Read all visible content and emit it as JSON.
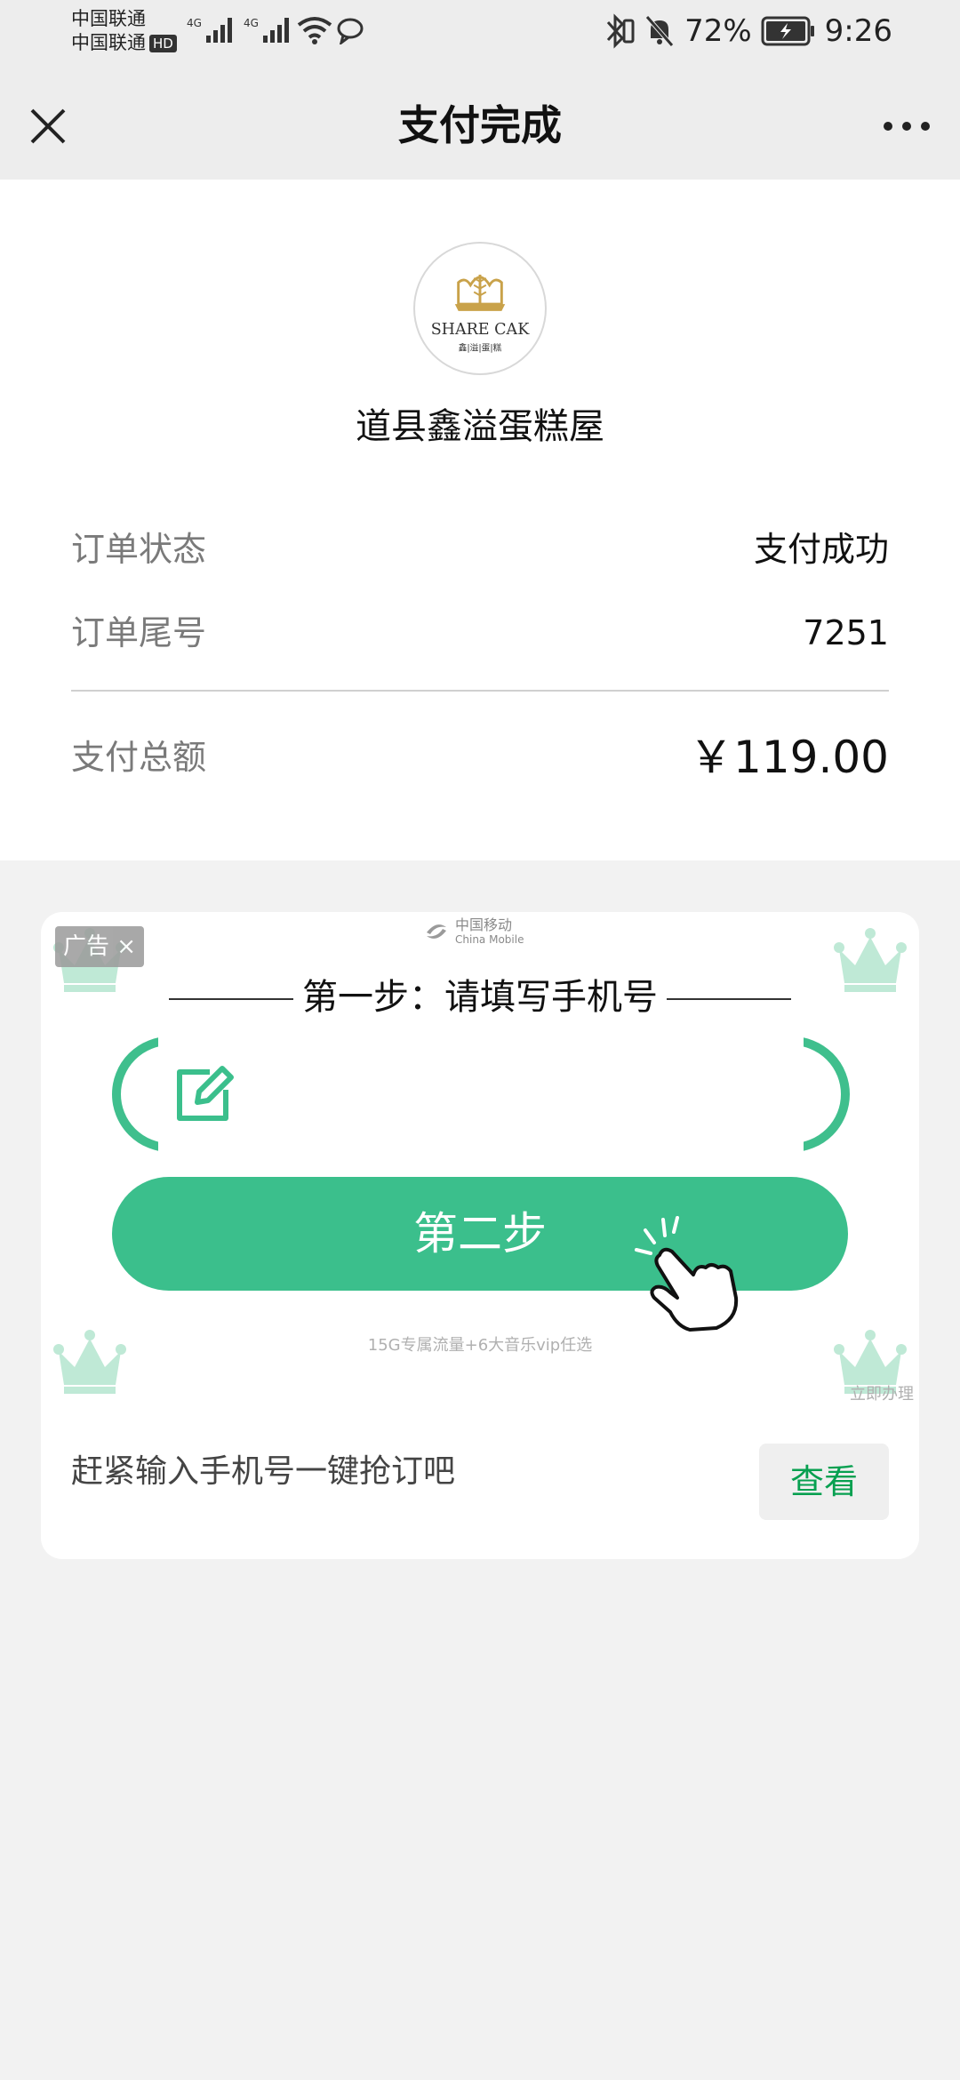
{
  "status_bar": {
    "carrier1": "中国联通",
    "carrier2": "中国联通",
    "hd": "HD",
    "net1": "4G",
    "net2": "4G",
    "battery": "72%",
    "time": "9:26"
  },
  "nav": {
    "title": "支付完成"
  },
  "merchant": {
    "logo_text": "SHARE CAK",
    "logo_sub": "鑫|溢|蛋|糕",
    "name": "道县鑫溢蛋糕屋"
  },
  "order": {
    "status_label": "订单状态",
    "status_value": "支付成功",
    "tail_label": "订单尾号",
    "tail_value": "7251",
    "total_label": "支付总额",
    "total_value": "￥119.00"
  },
  "ad": {
    "badge": "广告 ×",
    "brand_cn": "中国移动",
    "brand_en": "China Mobile",
    "step1": "第一步：请填写手机号",
    "step2": "第二步",
    "sub": "15G专属流量+6大音乐vip任选",
    "cta_small": "立即办理",
    "text": "赶紧输入手机号一键抢订吧",
    "view_button": "查看",
    "accent_color": "#3bbf8c"
  }
}
